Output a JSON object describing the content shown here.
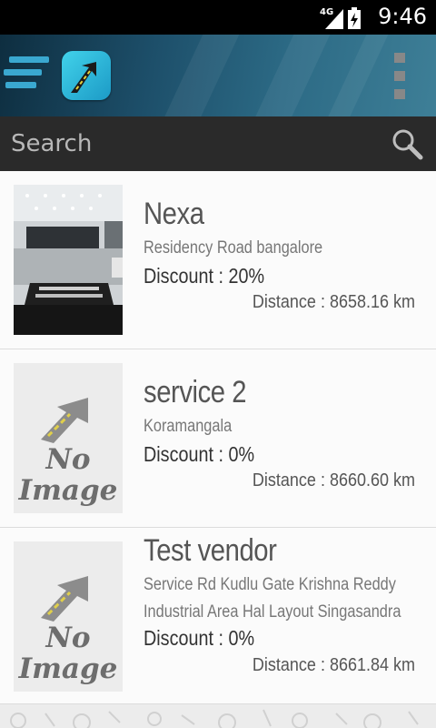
{
  "status_bar": {
    "time": "9:46",
    "network": "4G"
  },
  "search": {
    "placeholder": "Search"
  },
  "vendors": [
    {
      "name": "Nexa",
      "address": "Residency Road bangalore",
      "discount": "Discount : 20%",
      "distance_label": "Distance",
      "distance": ": 8658.16 km",
      "image": "showroom-photo"
    },
    {
      "name": "service 2",
      "address": "Koramangala",
      "discount": "Discount : 0%",
      "distance_label": "Distance",
      "distance": ": 8660.60 km",
      "image": "no-image"
    },
    {
      "name": "Test vendor",
      "address": "Service Rd Kudlu Gate Krishna Reddy Industrial Area Hal Layout Singasandra",
      "discount": "Discount : 0%",
      "distance_label": "Distance",
      "distance": ": 8661.84 km",
      "image": "no-image"
    }
  ],
  "no_image_text": {
    "line1": "No",
    "line2": "Image"
  },
  "colors": {
    "app_bar": "#1d4f6a",
    "search_bar": "#2a2a2a",
    "logo": "#41d2ea",
    "menu": "#3aa8d0"
  }
}
